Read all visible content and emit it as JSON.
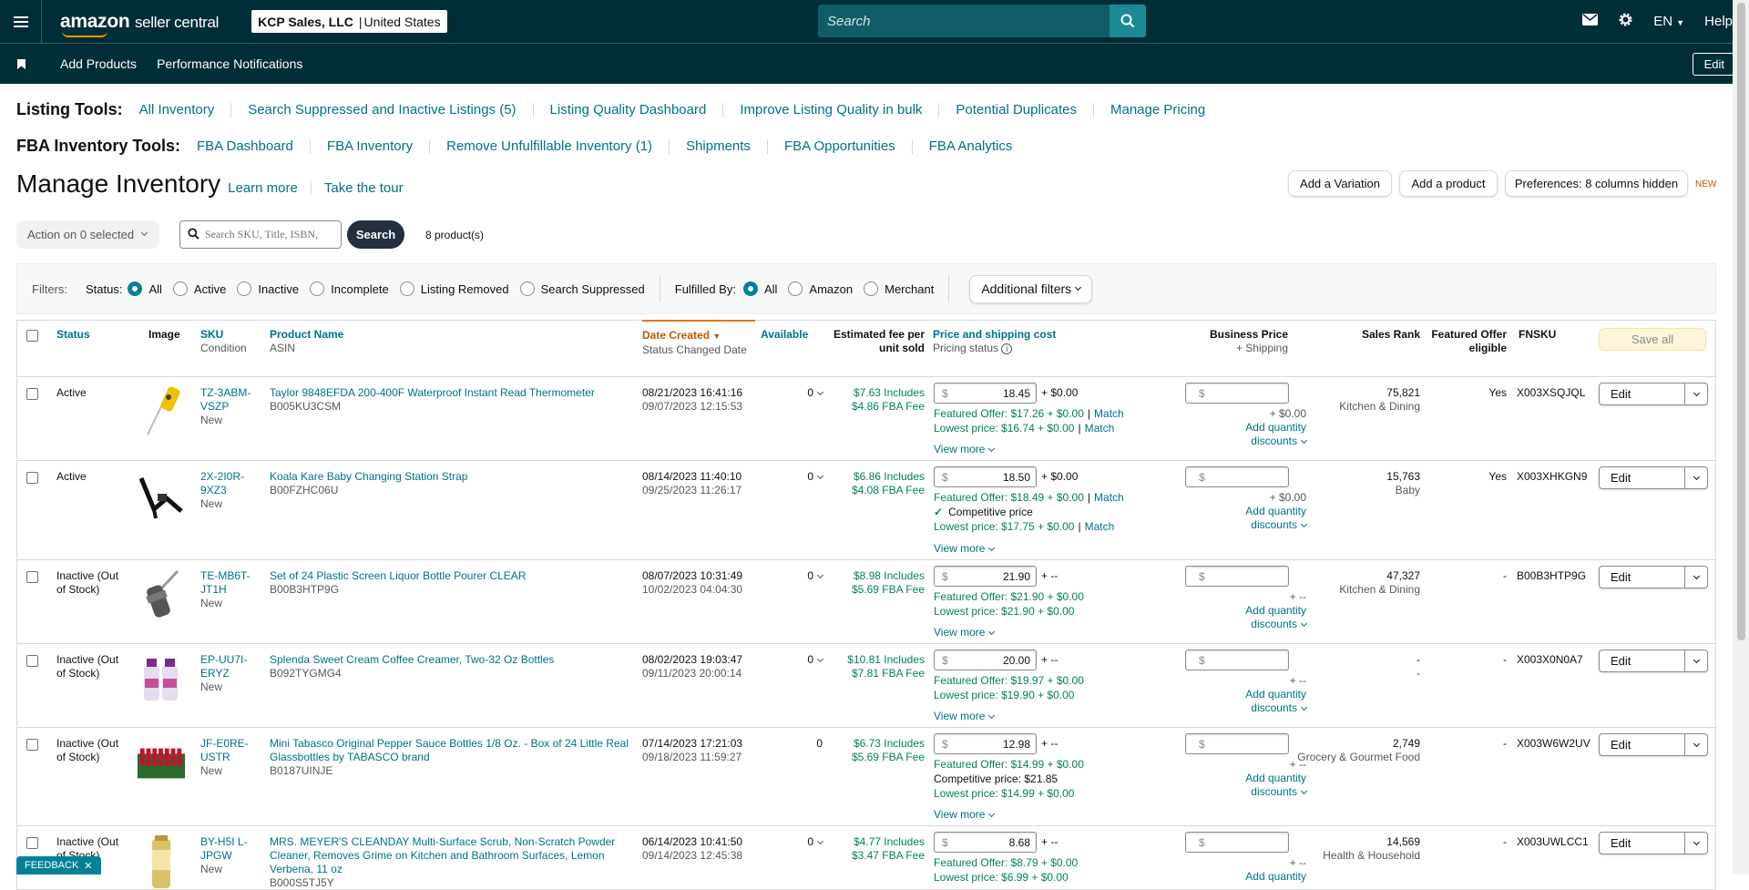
{
  "header": {
    "logo": {
      "brand": "amazon",
      "product": "seller central"
    },
    "account": {
      "name": "KCP Sales, LLC",
      "region": "United States"
    },
    "search_placeholder": "Search",
    "lang": "EN",
    "help": "Help"
  },
  "navbar": {
    "items": [
      "Add Products",
      "Performance Notifications"
    ],
    "edit": "Edit"
  },
  "listing_tools": {
    "label": "Listing Tools:",
    "links": [
      "All Inventory",
      "Search Suppressed and Inactive Listings (5)",
      "Listing Quality Dashboard",
      "Improve Listing Quality in bulk",
      "Potential Duplicates",
      "Manage Pricing"
    ]
  },
  "fba_tools": {
    "label": "FBA Inventory Tools:",
    "links": [
      "FBA Dashboard",
      "FBA Inventory",
      "Remove Unfulfillable Inventory (1)",
      "Shipments",
      "FBA Opportunities",
      "FBA Analytics"
    ]
  },
  "page": {
    "title": "Manage Inventory",
    "learn_more": "Learn more",
    "tour": "Take the tour",
    "add_variation": "Add a Variation",
    "add_product": "Add a product",
    "preferences": "Preferences: 8 columns hidden",
    "new_tag": "NEW"
  },
  "toolbar": {
    "action": "Action on 0 selected",
    "search_placeholder": "Search SKU, Title, ISBN,",
    "search_btn": "Search",
    "count": "8 product(s)"
  },
  "filters": {
    "label": "Filters:",
    "status_label": "Status:",
    "status": [
      "All",
      "Active",
      "Inactive",
      "Incomplete",
      "Listing Removed",
      "Search Suppressed"
    ],
    "fulfilled_label": "Fulfilled By:",
    "fulfilled": [
      "All",
      "Amazon",
      "Merchant"
    ],
    "additional": "Additional filters"
  },
  "columns": {
    "status": "Status",
    "image": "Image",
    "sku": "SKU",
    "condition": "Condition",
    "name": "Product Name",
    "asin": "ASIN",
    "date_created": "Date Created",
    "status_changed": "Status Changed Date",
    "available": "Available",
    "fee": "Estimated fee per unit sold",
    "price": "Price and shipping cost",
    "pricing_status": "Pricing status",
    "business_price": "Business Price",
    "plus_shipping": "+ Shipping",
    "sales_rank": "Sales Rank",
    "featured": "Featured Offer eligible",
    "fnsku": "FNSKU",
    "save_all": "Save all"
  },
  "labels": {
    "view_more": "View more",
    "add_qty": "Add quantity",
    "discounts": "discounts",
    "edit": "Edit",
    "match": "Match",
    "dollar": "$"
  },
  "rows": [
    {
      "status": "Active",
      "sku": "TZ-3ABM-VSZP",
      "condition": "New",
      "name": "Taylor 9848EFDA 200-400F Waterproof Instant Read Thermometer",
      "asin": "B005KU3CSM",
      "created": "08/21/2023 16:41:16",
      "changed": "09/07/2023 12:15:53",
      "available": "0",
      "fee1": "$7.63 Includes",
      "fee2": "$4.86 FBA Fee",
      "price": "18.45",
      "ship": "+ $0.00",
      "line1": "Featured Offer: $17.26 + $0.00",
      "line1_match": "Match",
      "line2": "",
      "line3": "Lowest price: $16.74 + $0.00",
      "line3_match": "Match",
      "biz_ship": "+ $0.00",
      "rank": "75,821",
      "rank_cat": "Kitchen & Dining",
      "featured": "Yes",
      "fnsku": "X003XSQJQL"
    },
    {
      "status": "Active",
      "sku": "2X-2I0R-9XZ3",
      "condition": "New",
      "name": "Koala Kare Baby Changing Station Strap",
      "asin": "B00FZHC06U",
      "created": "08/14/2023 11:40:10",
      "changed": "09/25/2023 11:26:17",
      "available": "0",
      "fee1": "$6.86 Includes",
      "fee2": "$4.08 FBA Fee",
      "price": "18.50",
      "ship": "+ $0.00",
      "line1": "Featured Offer: $18.49 + $0.00",
      "line1_match": "Match",
      "line2": "Competitive price",
      "line3": "Lowest price: $17.75 + $0.00",
      "line3_match": "Match",
      "biz_ship": "+ $0.00",
      "rank": "15,763",
      "rank_cat": "Baby",
      "featured": "Yes",
      "fnsku": "X003XHKGN9"
    },
    {
      "status": "Inactive (Out of Stock)",
      "sku": "TE-MB6T-JT1H",
      "condition": "New",
      "name": "Set of 24 Plastic Screen Liquor Bottle Pourer CLEAR",
      "asin": "B00B3HTP9G",
      "created": "08/07/2023 10:31:49",
      "changed": "10/02/2023 04:04:30",
      "available": "0",
      "fee1": "$8.98 Includes",
      "fee2": "$5.69 FBA Fee",
      "price": "21.90",
      "ship": "+ --",
      "line1": "Featured Offer: $21.90 + $0.00",
      "line1_match": "",
      "line2": "",
      "line3": "Lowest price: $21.90 + $0.00",
      "line3_match": "",
      "biz_ship": "+ --",
      "rank": "47,327",
      "rank_cat": "Kitchen & Dining",
      "featured": "-",
      "fnsku": "B00B3HTP9G"
    },
    {
      "status": "Inactive (Out of Stock)",
      "sku": "EP-UU7I-ERYZ",
      "condition": "New",
      "name": "Splenda Sweet Cream Coffee Creamer, Two-32 Oz Bottles",
      "asin": "B092TYGMG4",
      "created": "08/02/2023 19:03:47",
      "changed": "09/11/2023 20:00:14",
      "available": "0",
      "fee1": "$10.81 Includes",
      "fee2": "$7.81 FBA Fee",
      "price": "20.00",
      "ship": "+ --",
      "line1": "Featured Offer: $19.97 + $0.00",
      "line1_match": "",
      "line2": "",
      "line3": "Lowest price: $19.90 + $0.00",
      "line3_match": "",
      "biz_ship": "+ --",
      "rank": "-",
      "rank_cat": "-",
      "featured": "-",
      "fnsku": "X003X0N0A7"
    },
    {
      "status": "Inactive (Out of Stock)",
      "sku": "JF-E0RE-USTR",
      "condition": "New",
      "name": "Mini Tabasco Original Pepper Sauce Bottles 1/8 Oz. - Box of 24 Little Real Glassbottles by TABASCO brand",
      "asin": "B0187UINJE",
      "created": "07/14/2023 17:21:03",
      "changed": "09/18/2023 11:59:27",
      "available": "0",
      "fee1": "$6.73 Includes",
      "fee2": "$5.69 FBA Fee",
      "price": "12.98",
      "ship": "+ --",
      "line1": "Featured Offer: $14.99 + $0.00",
      "line1_match": "",
      "line2": "Competitive price: $21.85",
      "line3": "Lowest price: $14.99 + $0.00",
      "line3_match": "",
      "biz_ship": "+ --",
      "rank": "2,749",
      "rank_cat": "Grocery & Gourmet Food",
      "featured": "-",
      "fnsku": "X003W6W2UV"
    },
    {
      "status": "Inactive (Out of Stock)",
      "sku": "BY-H5I L-JPGW",
      "condition": "New",
      "name": "MRS. MEYER'S CLEANDAY Multi-Surface Scrub, Non-Scratch Powder Cleaner, Removes Grime on Kitchen and Bathroom Surfaces, Lemon Verbena, 11 oz",
      "asin": "B000S5TJ5Y",
      "created": "06/14/2023 10:41:50",
      "changed": "09/14/2023 12:45:38",
      "available": "0",
      "fee1": "$4.77 Includes",
      "fee2": "$3.47 FBA Fee",
      "price": "8.68",
      "ship": "+ --",
      "line1": "Featured Offer: $8.79 + $0.00",
      "line1_match": "",
      "line2": "",
      "line3": "Lowest price: $6.99 + $0.00",
      "line3_match": "",
      "biz_ship": "+ --",
      "rank": "14,569",
      "rank_cat": "Health & Household",
      "featured": "-",
      "fnsku": "X003UWLCC1"
    }
  ],
  "feedback": "FEEDBACK"
}
